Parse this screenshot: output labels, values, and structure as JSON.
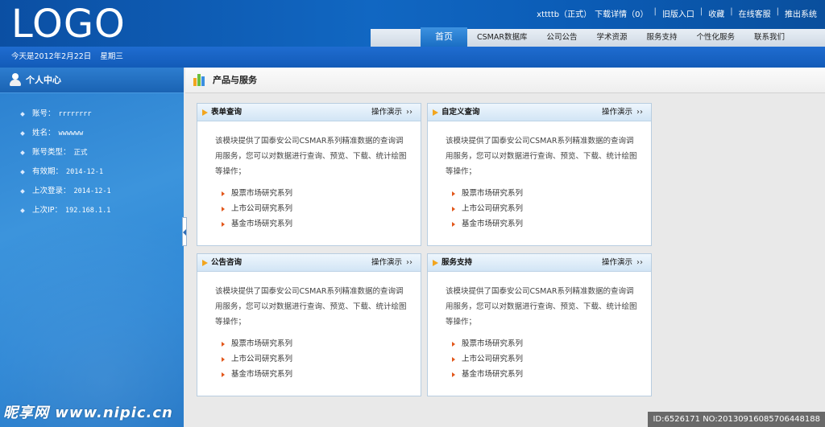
{
  "header": {
    "logo": "LOGO",
    "top_links": [
      "xttttb（正式）",
      "下载详情（0）",
      "旧版入口",
      "收藏",
      "在线客服",
      "推出系统"
    ],
    "nav": [
      "首页",
      "CSMAR数据库",
      "公司公告",
      "学术资源",
      "服务支持",
      "个性化服务",
      "联系我们"
    ]
  },
  "datebar": {
    "date": "今天是2012年2月22日",
    "weekday": "星期三"
  },
  "sidebar": {
    "title": "个人中心",
    "items": [
      {
        "label": "账号：",
        "value": "rrrrrrrr"
      },
      {
        "label": "姓名：",
        "value": "wwwwww"
      },
      {
        "label": "账号类型：",
        "value": "正式"
      },
      {
        "label": "有效期：",
        "value": "2014-12-1"
      },
      {
        "label": "上次登录：",
        "value": "2014-12-1"
      },
      {
        "label": "上次IP：",
        "value": "192.168.1.1"
      }
    ]
  },
  "main": {
    "title": "产品与服务",
    "panels": [
      {
        "title": "表单查询",
        "demo": "操作演示",
        "desc": "该模块提供了国泰安公司CSMAR系列精准数据的查询调用服务，您可以对数据进行查询、预览、下载、统计绘图等操作；",
        "links": [
          "股票市场研究系列",
          "上市公司研究系列",
          "基金市场研究系列"
        ]
      },
      {
        "title": "自定义查询",
        "demo": "操作演示",
        "desc": "该模块提供了国泰安公司CSMAR系列精准数据的查询调用服务，您可以对数据进行查询、预览、下载、统计绘图等操作；",
        "links": [
          "股票市场研究系列",
          "上市公司研究系列",
          "基金市场研究系列"
        ]
      },
      {
        "title": "公告咨询",
        "demo": "操作演示",
        "desc": "该模块提供了国泰安公司CSMAR系列精准数据的查询调用服务，您可以对数据进行查询、预览、下载、统计绘图等操作；",
        "links": [
          "股票市场研究系列",
          "上市公司研究系列",
          "基金市场研究系列"
        ]
      },
      {
        "title": "服务支持",
        "demo": "操作演示",
        "desc": "该模块提供了国泰安公司CSMAR系列精准数据的查询调用服务，您可以对数据进行查询、预览、下载、统计绘图等操作；",
        "links": [
          "股票市场研究系列",
          "上市公司研究系列",
          "基金市场研究系列"
        ]
      }
    ]
  },
  "watermark": {
    "site": "昵享网 www.nipic.cn",
    "id": "ID:6526171 NO:20130916085706448188"
  },
  "colors": {
    "header_blue": "#0b5cb6",
    "sidebar_blue": "#2c86d5",
    "nav_active": "#1a6ec4",
    "accent_orange": "#f2a51e",
    "link_arrow": "#e2571b"
  }
}
